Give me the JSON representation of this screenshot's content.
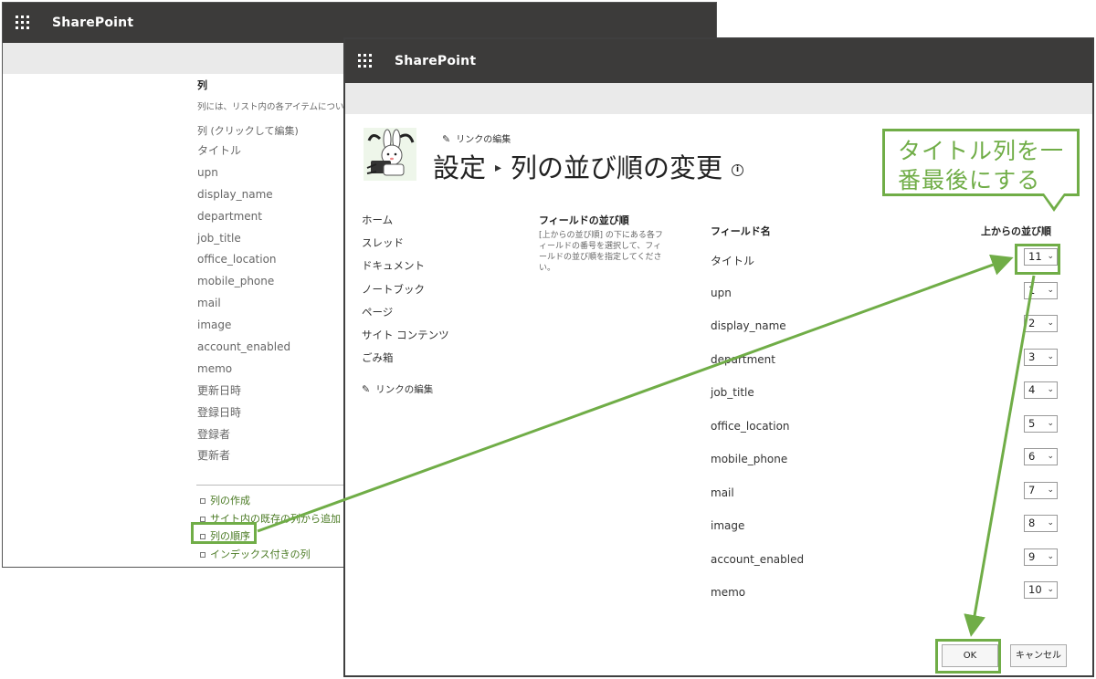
{
  "back_window": {
    "app_title": "SharePoint",
    "columns_section_title": "列",
    "columns_description": "列には、リスト内の各アイテムについて",
    "columns_header": "列 (クリックして編集)",
    "columns": [
      "タイトル",
      "upn",
      "display_name",
      "department",
      "job_title",
      "office_location",
      "mobile_phone",
      "mail",
      "image",
      "account_enabled",
      "memo",
      "更新日時",
      "登録日時",
      "登録者",
      "更新者"
    ],
    "links": [
      "列の作成",
      "サイト内の既存の列から追加",
      "列の順序",
      "インデックス付きの列"
    ]
  },
  "front_window": {
    "app_title": "SharePoint",
    "edit_links_label": "リンクの編集",
    "breadcrumb": {
      "parent": "設定",
      "current": "列の並び順の変更"
    },
    "info_icon": "info-icon",
    "left_nav": [
      "ホーム",
      "スレッド",
      "ドキュメント",
      "ノートブック",
      "ページ",
      "サイト コンテンツ",
      "ごみ箱"
    ],
    "left_nav_edit_label": "リンクの編集",
    "field_order_title": "フィールドの並び順",
    "field_order_description": "[上からの並び順] の下にある各フィールドの番号を選択して、フィールドの並び順を指定してください。",
    "table_header_field": "フィールド名",
    "table_header_order": "上からの並び順",
    "fields": [
      {
        "name": "タイトル",
        "order": "11"
      },
      {
        "name": "upn",
        "order": "1"
      },
      {
        "name": "display_name",
        "order": "2"
      },
      {
        "name": "department",
        "order": "3"
      },
      {
        "name": "job_title",
        "order": "4"
      },
      {
        "name": "office_location",
        "order": "5"
      },
      {
        "name": "mobile_phone",
        "order": "6"
      },
      {
        "name": "mail",
        "order": "7"
      },
      {
        "name": "image",
        "order": "8"
      },
      {
        "name": "account_enabled",
        "order": "9"
      },
      {
        "name": "memo",
        "order": "10"
      }
    ],
    "ok_label": "OK",
    "cancel_label": "キャンセル"
  },
  "annotation": {
    "callout_line1": "タイトル列を一",
    "callout_line2": "番最後にする",
    "color": "#70ad47"
  }
}
